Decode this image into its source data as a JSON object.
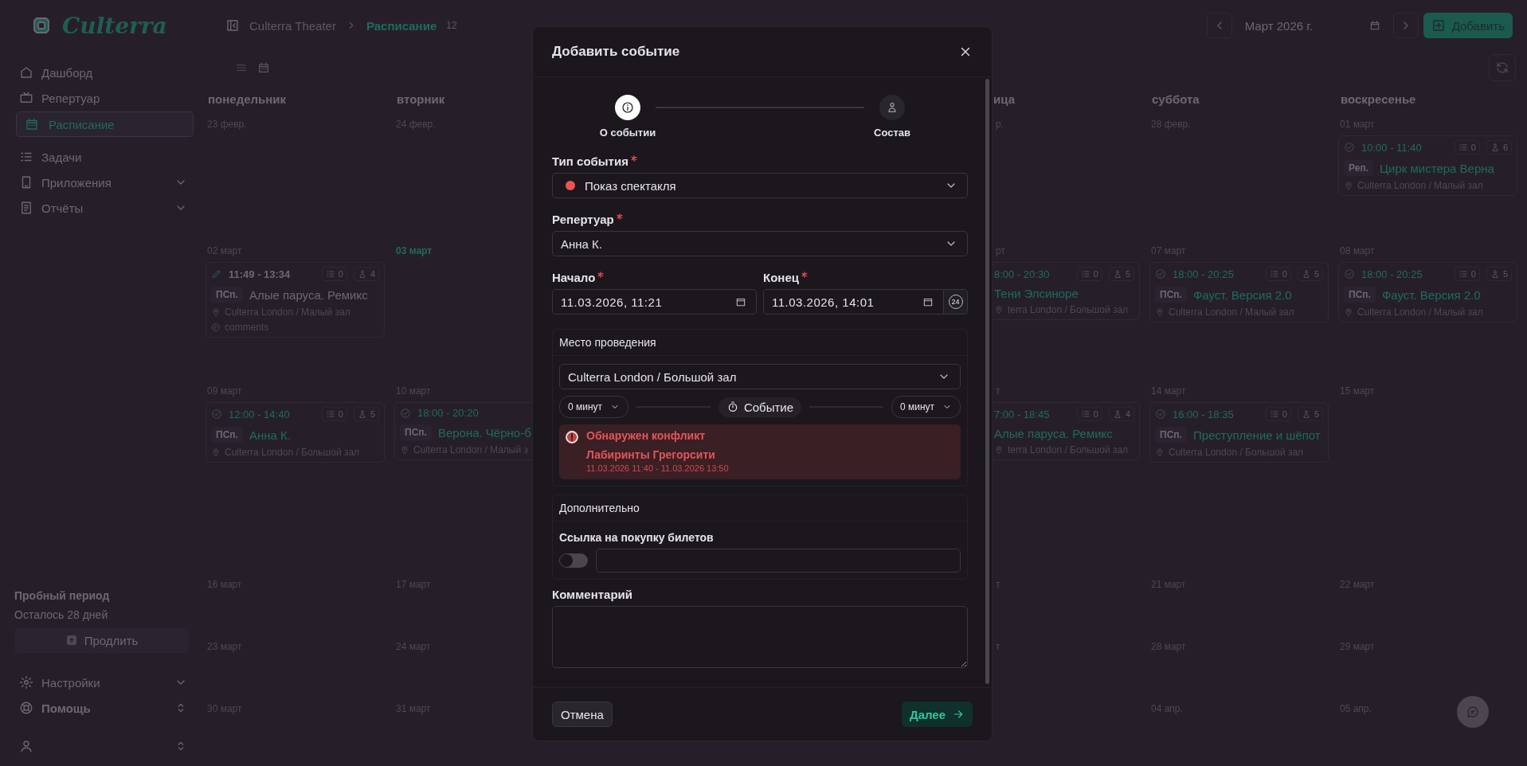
{
  "logo": {
    "text": "Culterra"
  },
  "breadcrumb": {
    "root": "Culterra Theater",
    "current": "Расписание",
    "count": "12"
  },
  "sidebar": {
    "items": [
      {
        "label": "Дашборд",
        "selected": false,
        "expandable": false
      },
      {
        "label": "Репертуар",
        "selected": false,
        "expandable": false
      },
      {
        "label": "Расписание",
        "selected": true,
        "expandable": false
      },
      {
        "label": "Задачи",
        "selected": false,
        "expandable": false
      },
      {
        "label": "Приложения",
        "selected": false,
        "expandable": true
      },
      {
        "label": "Отчёты",
        "selected": false,
        "expandable": true
      }
    ],
    "trial": {
      "title": "Пробный период",
      "subtitle": "Осталось 28 дней",
      "button": "Продлить"
    },
    "footer_items": [
      {
        "label": "Настройки",
        "kind": "chevron"
      },
      {
        "label": "Помощь",
        "kind": "updown"
      }
    ]
  },
  "toolbar": {
    "month": "Март 2026 г.",
    "add_button": "Добавить"
  },
  "calendar": {
    "columns": [
      {
        "label": "понедельник",
        "days": [
          {
            "date": "23 февр.",
            "today": false
          },
          {
            "date": "02 март",
            "today": false,
            "events": [
              {
                "kind": "draft",
                "time": "11:49 - 13:34",
                "tasks": "0",
                "people": "4",
                "tag": "ПСп.",
                "title": "Алые паруса. Ремикс",
                "venue": "Culterra London / Малый зал",
                "comment": "comments"
              }
            ]
          },
          {
            "date": "09 март",
            "today": false,
            "events": [
              {
                "kind": "confirmed",
                "time": "12:00 - 14:40",
                "tasks": "0",
                "people": "5",
                "tag": "ПСп.",
                "title": "Анна К.",
                "venue": "Culterra London / Большой зал"
              }
            ]
          },
          {
            "date": "16 март",
            "today": false
          },
          {
            "date": "23 март",
            "today": false
          },
          {
            "date": "30 март",
            "today": false
          }
        ]
      },
      {
        "label": "вторник",
        "days": [
          {
            "date": "24 февр.",
            "today": false
          },
          {
            "date": "03 март",
            "today": true
          },
          {
            "date": "10 март",
            "today": false,
            "events": [
              {
                "kind": "confirmed",
                "time": "18:00 - 20:20",
                "tag": "ПСп.",
                "title": "Верона. Чёрно-б",
                "venue": "Culterra London / Малый з"
              }
            ]
          },
          {
            "date": "17 март",
            "today": false
          },
          {
            "date": "24 март",
            "today": false
          },
          {
            "date": "31 март",
            "today": false
          }
        ]
      },
      {
        "label": "ица",
        "days": [
          {
            "date": "р.",
            "today": false
          },
          {
            "date": "рт",
            "today": false,
            "events": [
              {
                "kind": "confirmed",
                "time": "8:00 - 20:30",
                "tasks": "0",
                "people": "5",
                "title": "Тени Элсиноре",
                "venue": "terra London / Большой зал"
              }
            ]
          },
          {
            "date": "т",
            "today": false,
            "events": [
              {
                "kind": "confirmed",
                "time": "7:00 - 18:45",
                "tasks": "0",
                "people": "4",
                "title": "Алые паруса. Ремикс",
                "venue": "terra London / Большой зал"
              }
            ]
          },
          {
            "date": "т",
            "today": false
          },
          {
            "date": "т",
            "today": false
          }
        ]
      },
      {
        "label": "суббота",
        "days": [
          {
            "date": "28 февр.",
            "today": false
          },
          {
            "date": "07 март",
            "today": false,
            "events": [
              {
                "kind": "confirmed",
                "time": "18:00 - 20:25",
                "tasks": "0",
                "people": "5",
                "tag": "ПСп.",
                "title": "Фауст. Версия 2.0",
                "venue": "Culterra London / Малый зал"
              }
            ]
          },
          {
            "date": "14 март",
            "today": false,
            "events": [
              {
                "kind": "confirmed",
                "time": "16:00 - 18:35",
                "tasks": "0",
                "people": "5",
                "tag": "ПСп.",
                "title": "Преступление и шёпот",
                "venue": "Culterra London / Большой зал"
              }
            ]
          },
          {
            "date": "21 март",
            "today": false
          },
          {
            "date": "28 март",
            "today": false
          },
          {
            "date": "04 апр.",
            "today": false
          }
        ]
      },
      {
        "label": "воскресенье",
        "days": [
          {
            "date": "01 март",
            "today": false,
            "events": [
              {
                "kind": "confirmed",
                "time": "10:00 - 11:40",
                "tasks": "0",
                "people": "6",
                "tag": "Реп.",
                "title": "Цирк мистера Верна",
                "venue": "Culterra London / Малый зал"
              }
            ]
          },
          {
            "date": "08 март",
            "today": false,
            "events": [
              {
                "kind": "confirmed",
                "time": "18:00 - 20:25",
                "tasks": "0",
                "people": "5",
                "tag": "ПСп.",
                "title": "Фауст. Версия 2.0",
                "venue": "Culterra London / Малый зал"
              }
            ]
          },
          {
            "date": "15 март",
            "today": false
          },
          {
            "date": "22 март",
            "today": false
          },
          {
            "date": "29 март",
            "today": false
          },
          {
            "date": "05 апр.",
            "today": false
          }
        ]
      }
    ]
  },
  "modal": {
    "title": "Добавить событие",
    "steps": [
      {
        "label": "О событии",
        "selected": true
      },
      {
        "label": "Состав",
        "selected": false
      }
    ],
    "event_type": {
      "label": "Тип события",
      "required": true,
      "value": "Показ спектакля",
      "color": "#f05252"
    },
    "repertoire": {
      "label": "Репертуар",
      "required": true,
      "value": "Анна К."
    },
    "start": {
      "label": "Начало",
      "required": true,
      "value": "11.03.2026, 11:21"
    },
    "end": {
      "label": "Конец",
      "required": true,
      "value": "11.03.2026, 14:01",
      "format_button": "24"
    },
    "venue": {
      "title": "Место проведения",
      "value": "Culterra London / Большой зал",
      "before": "0 минут",
      "center": "Событие",
      "after": "0 минут",
      "conflict": {
        "title": "Обнаружен конфликт",
        "event": "Лабиринты Грегорсити",
        "time": "11.03.2026 11:40 - 11.03.2026 13:50"
      }
    },
    "extra": {
      "title": "Дополнительно",
      "ticket_label": "Ссылка на покупку билетов",
      "ticket_on": false
    },
    "comment": {
      "label": "Комментарий"
    },
    "cancel": "Отмена",
    "next": "Далее"
  }
}
